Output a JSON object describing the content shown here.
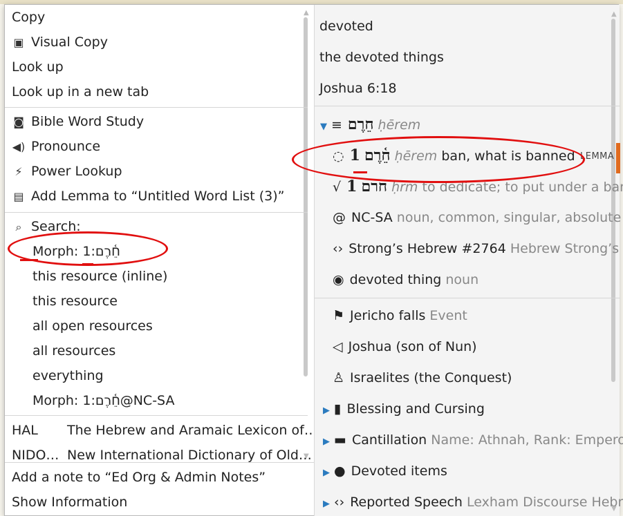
{
  "left_menu": {
    "copy": "Copy",
    "visual_copy": "Visual Copy",
    "look_up": "Look up",
    "look_up_new_tab": "Look up in a new tab",
    "bible_word_study": "Bible Word Study",
    "pronounce": "Pronounce",
    "power_lookup": "Power Lookup",
    "add_lemma": "Add Lemma to “Untitled Word List (3)”",
    "search": "Search:",
    "search_items": [
      "Morph: 1:חֵ֫רֶם",
      "this resource (inline)",
      "this resource",
      "all open resources",
      "all resources",
      "everything",
      "Morph: 1:חֵ֫רֶם@NC-SA"
    ],
    "resources": [
      {
        "abbr": "HAL",
        "title": "The Hebrew and Aramaic Lexicon of…"
      },
      {
        "abbr": "NIDO…",
        "title": "New International Dictionary of Old…"
      }
    ],
    "add_note": "Add a note to “Ed Org & Admin Notes”",
    "show_information": "Show Information"
  },
  "right_panel": {
    "texts": [
      "devoted",
      "the devoted things",
      "Joshua 6:18"
    ],
    "lemma_group": {
      "hebrew": "חֵרֶם",
      "translit": "ḥērem"
    },
    "sense": {
      "num": "1",
      "hebrew": "חֵ֫רֶם",
      "translit": "ḥērem",
      "gloss": "ban, what is banned",
      "tag": "LEMMA"
    },
    "root": {
      "num": "1",
      "hebrew": "חרם",
      "translit": "ḥrm",
      "gloss": "to dedicate; to put under a ban"
    },
    "morph": {
      "code": "NC-SA",
      "desc": "noun, common, singular, absolute"
    },
    "strongs": {
      "label": "Strong’s Hebrew #2764",
      "desc": "Hebrew Strong’s"
    },
    "sense2": {
      "label": "devoted thing",
      "desc": "noun"
    },
    "event": {
      "label": "Jericho falls",
      "desc": "Event"
    },
    "person": {
      "label": "Joshua (son of Nun)"
    },
    "group": {
      "label": "Israelites (the Conquest)"
    },
    "collapsed": [
      {
        "label": "Blessing and Cursing",
        "desc": ""
      },
      {
        "label": "Cantillation",
        "desc": "Name: Athnah, Rank: Empero…"
      },
      {
        "label": "Devoted items",
        "desc": ""
      },
      {
        "label": "Reported Speech",
        "desc": "Lexham Discourse Hebre…"
      }
    ]
  },
  "colors": {
    "accent": "#2b7bbf",
    "annotation": "#e10f0f",
    "selection_bar": "#e06b1f"
  }
}
